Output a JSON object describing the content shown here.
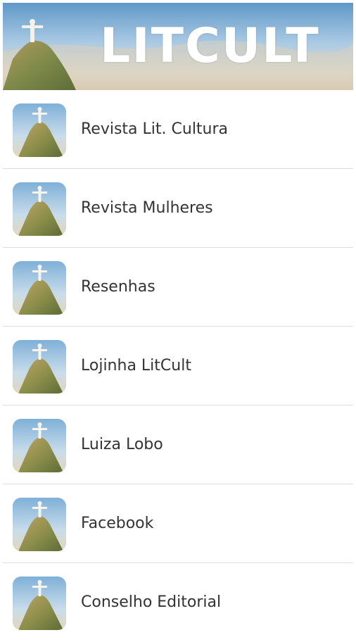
{
  "header": {
    "title": "LITCULT",
    "image_icon": "christ-redeemer-icon"
  },
  "menu": {
    "item_icon": "christ-redeemer-icon",
    "items": [
      {
        "label": "Revista Lit. Cultura"
      },
      {
        "label": "Revista Mulheres"
      },
      {
        "label": "Resenhas"
      },
      {
        "label": "Lojinha LitCult"
      },
      {
        "label": "Luiza Lobo"
      },
      {
        "label": "Facebook"
      },
      {
        "label": "Conselho Editorial"
      }
    ]
  }
}
